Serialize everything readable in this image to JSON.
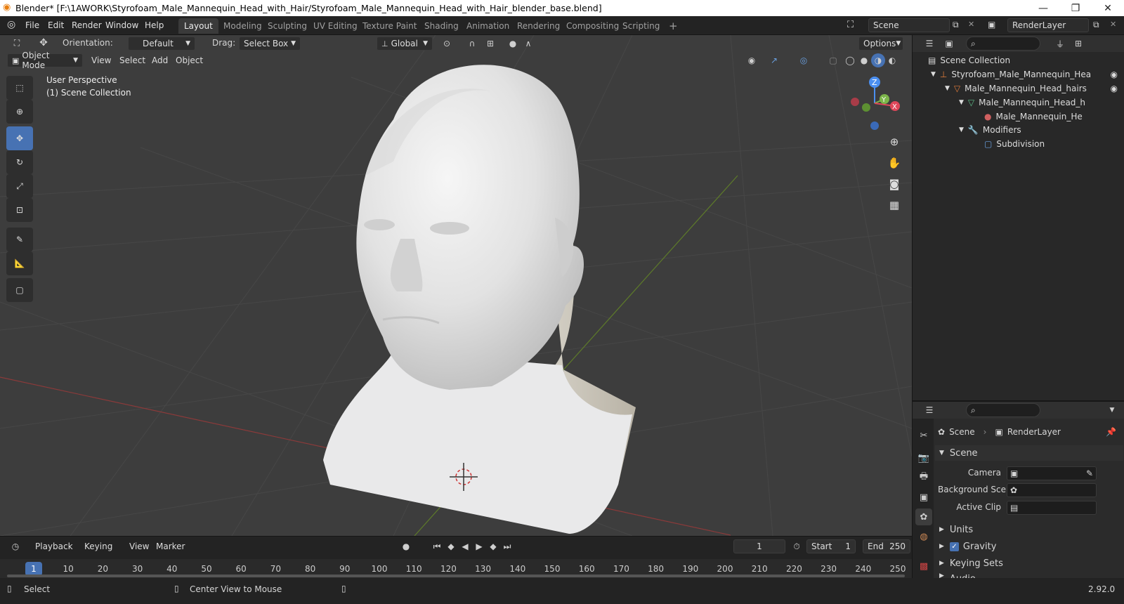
{
  "window": {
    "title": "Blender* [F:\\1AWORK\\Styrofoam_Male_Mannequin_Head_with_Hair/Styrofoam_Male_Mannequin_Head_with_Hair_blender_base.blend]",
    "minimize": "—",
    "restore": "❐",
    "close": "✕"
  },
  "menu": [
    "File",
    "Edit",
    "Render",
    "Window",
    "Help"
  ],
  "workspaces": [
    "Layout",
    "Modeling",
    "Sculpting",
    "UV Editing",
    "Texture Paint",
    "Shading",
    "Animation",
    "Rendering",
    "Compositing",
    "Scripting"
  ],
  "scene_field": "Scene",
  "view_layer_field": "RenderLayer",
  "header": {
    "orientation_label": "Orientation:",
    "orientation_value": "Default",
    "drag_label": "Drag:",
    "drag_value": "Select Box",
    "transform_orientation": "Global",
    "options": "Options"
  },
  "viewport": {
    "mode": "Object Mode",
    "menus": [
      "View",
      "Select",
      "Add",
      "Object"
    ],
    "info_line1": "User Perspective",
    "info_line2": "(1) Scene Collection",
    "gizmo_labels": {
      "z": "Z",
      "y": "Y",
      "x": "X"
    }
  },
  "outliner": {
    "root": "Scene Collection",
    "items": [
      "Styrofoam_Male_Mannequin_Hea",
      "Male_Mannequin_Head_hairs",
      "Male_Mannequin_Head_h",
      "Male_Mannequin_He",
      "Modifiers",
      "Subdivision"
    ]
  },
  "properties": {
    "breadcrumb_scene": "Scene",
    "breadcrumb_layer": "RenderLayer",
    "panel_title": "Scene",
    "camera_label": "Camera",
    "background_label": "Background Sce...",
    "active_clip_label": "Active Clip",
    "units": "Units",
    "gravity": "Gravity",
    "keying_sets": "Keying Sets",
    "audio": "Audio"
  },
  "timeline": {
    "menus": [
      "Playback",
      "Keying",
      "View",
      "Marker"
    ],
    "current_frame": "1",
    "start_label": "Start",
    "start_value": "1",
    "end_label": "End",
    "end_value": "250",
    "ticks": [
      "1",
      "10",
      "20",
      "30",
      "40",
      "50",
      "60",
      "70",
      "80",
      "90",
      "100",
      "110",
      "120",
      "130",
      "140",
      "150",
      "160",
      "170",
      "180",
      "190",
      "200",
      "210",
      "220",
      "230",
      "240",
      "250"
    ]
  },
  "status": {
    "select": "Select",
    "center_view": "Center View to Mouse",
    "version": "2.92.0"
  }
}
